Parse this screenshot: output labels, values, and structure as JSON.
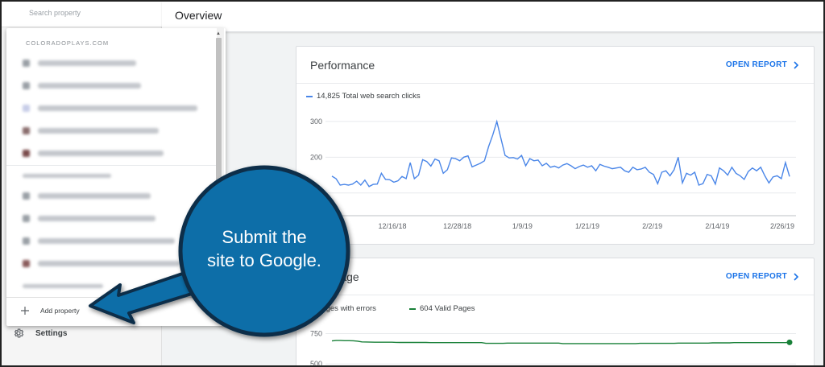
{
  "sidebar": {
    "search_placeholder": "Search property",
    "settings_label": "Settings"
  },
  "header": {
    "title": "Overview"
  },
  "property_menu": {
    "group_label": "COLORADOPLAYS.COM",
    "add_property_label": "Add property"
  },
  "performance": {
    "title": "Performance",
    "open_report": "OPEN REPORT",
    "legend_label": "14,825 Total web search clicks",
    "line_color": "#4a86e8",
    "chart_data": {
      "type": "line",
      "title": "",
      "xlabel": "",
      "ylabel": "",
      "ylim": [
        50,
        320
      ],
      "yticks": [
        "300",
        "200",
        "100"
      ],
      "xticks": [
        "12/16/18",
        "12/28/18",
        "1/9/19",
        "1/21/19",
        "2/2/19",
        "2/14/19",
        "2/26/19"
      ],
      "series": [
        {
          "name": "14,825 Total web search clicks",
          "values": [
            147,
            140,
            122,
            124,
            122,
            125,
            133,
            122,
            136,
            118,
            124,
            125,
            155,
            138,
            137,
            130,
            134,
            146,
            140,
            185,
            140,
            150,
            193,
            188,
            175,
            195,
            190,
            155,
            165,
            198,
            196,
            190,
            200,
            204,
            173,
            178,
            183,
            190,
            230,
            262,
            300,
            252,
            205,
            198,
            199,
            195,
            205,
            176,
            196,
            190,
            192,
            176,
            183,
            172,
            175,
            170,
            178,
            182,
            176,
            168,
            174,
            178,
            172,
            176,
            162,
            180,
            175,
            172,
            168,
            170,
            172,
            162,
            158,
            172,
            165,
            167,
            172,
            158,
            152,
            126,
            158,
            162,
            148,
            165,
            200,
            128,
            155,
            150,
            158,
            122,
            126,
            152,
            148,
            125,
            170,
            162,
            150,
            172,
            155,
            148,
            138,
            160,
            170,
            162,
            172,
            148,
            128,
            145,
            148,
            140,
            185,
            146
          ]
        }
      ]
    }
  },
  "coverage": {
    "title": "Coverage",
    "open_report": "OPEN REPORT",
    "legend_errors": "Pages with errors",
    "legend_valid": "604 Valid Pages",
    "line_color": "#188038",
    "chart_data": {
      "type": "line",
      "title": "",
      "xlabel": "",
      "ylabel": "",
      "ylim": [
        495,
        760
      ],
      "yticks": [
        "750",
        "500"
      ],
      "series": [
        {
          "name": "604 Valid Pages",
          "values": [
            690,
            693,
            693,
            692,
            692,
            691,
            688,
            682,
            681,
            680,
            679,
            679,
            679,
            679,
            679,
            678,
            677,
            677,
            677,
            677,
            677,
            677,
            677,
            676,
            676,
            676,
            676,
            676,
            676,
            676,
            676,
            676,
            676,
            676,
            676,
            676,
            670,
            670,
            670,
            670,
            670,
            672,
            672,
            672,
            672,
            672,
            672,
            672,
            672,
            672,
            672,
            672,
            672,
            672,
            668,
            668,
            668,
            668,
            668,
            668,
            668,
            668,
            668,
            668,
            668,
            668,
            668,
            668,
            668,
            668,
            668,
            668,
            670,
            670,
            670,
            670,
            670,
            670,
            670,
            670,
            670,
            672,
            672,
            672,
            672,
            672,
            672,
            672,
            672,
            674,
            674,
            674,
            674,
            674,
            676,
            676,
            676,
            676,
            676,
            676,
            676,
            676,
            676,
            676,
            676,
            676,
            676,
            678
          ]
        }
      ]
    }
  },
  "annotation": {
    "text_line1": "Submit the",
    "text_line2": "site to Google.",
    "bubble_color": "#0d6ea8"
  }
}
